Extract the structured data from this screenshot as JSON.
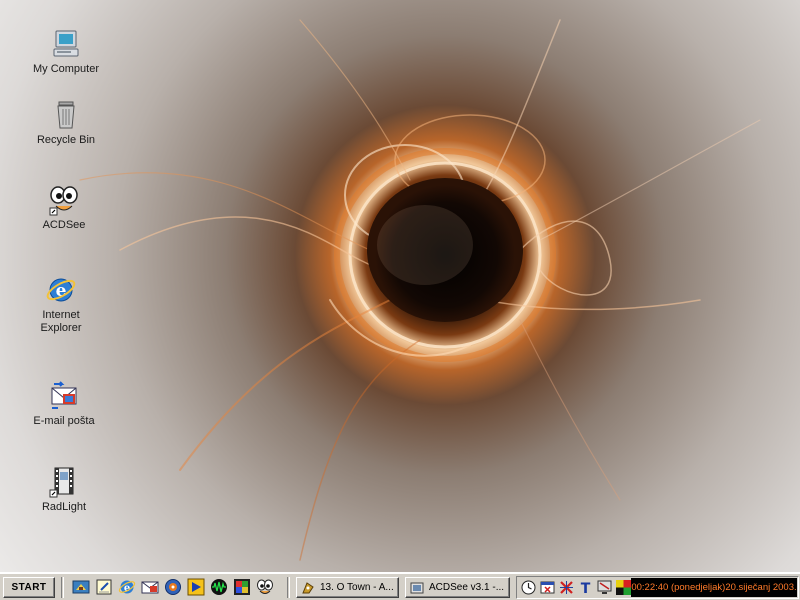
{
  "desktop": {
    "icons": [
      {
        "label": "My Computer",
        "icon": "my-computer-icon"
      },
      {
        "label": "Recycle Bin",
        "icon": "recycle-bin-icon"
      },
      {
        "label": "ACDSee",
        "icon": "acdsee-icon"
      },
      {
        "label": "Internet Explorer",
        "icon": "internet-explorer-icon"
      },
      {
        "label": "E-mail pošta",
        "icon": "email-icon"
      },
      {
        "label": "RadLight",
        "icon": "radlight-icon"
      }
    ]
  },
  "taskbar": {
    "start_label": "START",
    "quick_launch": [
      "show-desktop-icon",
      "notepad-icon",
      "internet-explorer-icon",
      "email-icon",
      "media-player-icon",
      "winamp-icon",
      "sound-wave-icon",
      "image-viewer-icon",
      "acdsee-icon"
    ],
    "tasks": [
      {
        "label": "13. O Town - A...",
        "icon": "winamp-task-icon"
      },
      {
        "label": "ACDSee v3.1 -...",
        "icon": "acdsee-task-icon"
      }
    ],
    "tray_icons": [
      "clock-face-icon",
      "close-window-icon",
      "network-x-icon",
      "text-t-icon",
      "monitor-icon",
      "color-square-icon"
    ],
    "clock_text": "00:22:40 (ponedjeljak)20.siječanj 2003."
  },
  "colors": {
    "taskbar_bg": "#d4d0c8",
    "clock_bg": "#000000",
    "clock_fg": "#ff7a2a"
  }
}
